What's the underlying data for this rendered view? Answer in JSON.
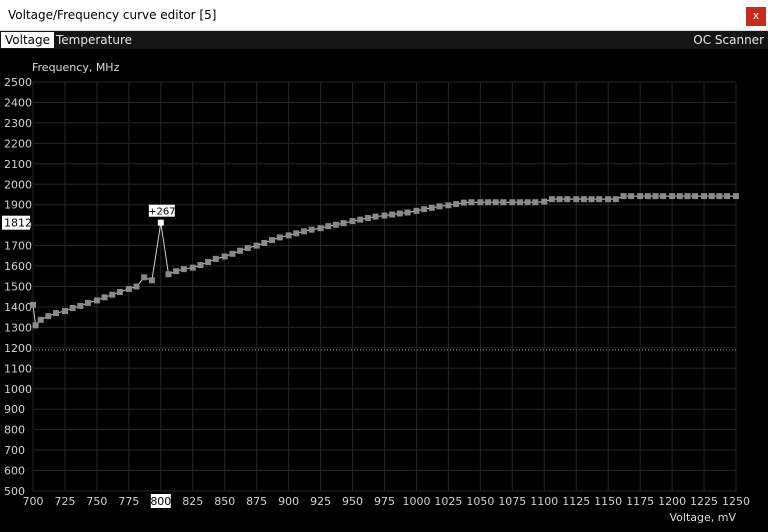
{
  "window": {
    "title": "Voltage/Frequency curve editor [5]",
    "close_label": "x"
  },
  "tabs": [
    {
      "label": "Voltage",
      "active": true
    },
    {
      "label": "Temperature",
      "active": false
    }
  ],
  "oc_scanner_label": "OC Scanner",
  "colors": {
    "background": "#000000",
    "grid": "#262626",
    "curve": "#8a8a8a",
    "selected_point": "#ffffff",
    "tab_active_bg": "#ffffff"
  },
  "chart_data": {
    "type": "line",
    "ylabel": "Frequency, MHz",
    "xlabel": "Voltage, mV",
    "xlim": [
      700,
      1250
    ],
    "ylim": [
      500,
      2500
    ],
    "x_ticks": [
      700,
      725,
      750,
      775,
      800,
      825,
      850,
      875,
      900,
      925,
      950,
      975,
      1000,
      1025,
      1050,
      1075,
      1100,
      1125,
      1150,
      1175,
      1200,
      1225,
      1250
    ],
    "y_ticks": [
      500,
      600,
      700,
      800,
      900,
      1000,
      1100,
      1200,
      1300,
      1400,
      1500,
      1600,
      1700,
      1800,
      1900,
      2000,
      2100,
      2200,
      2300,
      2400,
      2500
    ],
    "grid": true,
    "reference_line_y": 1190,
    "highlighted_x_tick": 800,
    "highlighted_y_value": "1812",
    "selected_point": {
      "x": 800,
      "y": 1812,
      "offset_label": "+267"
    },
    "series": [
      {
        "points": [
          [
            700,
            1410
          ],
          [
            702,
            1310
          ],
          [
            706,
            1337
          ],
          [
            712,
            1355
          ],
          [
            718,
            1370
          ],
          [
            725,
            1380
          ],
          [
            731,
            1395
          ],
          [
            737,
            1405
          ],
          [
            743,
            1420
          ],
          [
            750,
            1432
          ],
          [
            756,
            1447
          ],
          [
            762,
            1460
          ],
          [
            768,
            1473
          ],
          [
            775,
            1488
          ],
          [
            781,
            1500
          ],
          [
            787,
            1545
          ],
          [
            793,
            1530
          ],
          [
            800,
            1812
          ],
          [
            806,
            1560
          ],
          [
            812,
            1575
          ],
          [
            818,
            1585
          ],
          [
            825,
            1592
          ],
          [
            831,
            1605
          ],
          [
            837,
            1620
          ],
          [
            843,
            1635
          ],
          [
            850,
            1647
          ],
          [
            856,
            1660
          ],
          [
            862,
            1675
          ],
          [
            868,
            1688
          ],
          [
            875,
            1700
          ],
          [
            881,
            1713
          ],
          [
            887,
            1727
          ],
          [
            893,
            1740
          ],
          [
            900,
            1750
          ],
          [
            906,
            1760
          ],
          [
            912,
            1770
          ],
          [
            918,
            1778
          ],
          [
            925,
            1785
          ],
          [
            931,
            1795
          ],
          [
            937,
            1802
          ],
          [
            943,
            1810
          ],
          [
            950,
            1820
          ],
          [
            956,
            1827
          ],
          [
            962,
            1835
          ],
          [
            968,
            1842
          ],
          [
            975,
            1847
          ],
          [
            981,
            1852
          ],
          [
            987,
            1857
          ],
          [
            993,
            1862
          ],
          [
            1000,
            1870
          ],
          [
            1006,
            1878
          ],
          [
            1012,
            1885
          ],
          [
            1018,
            1892
          ],
          [
            1025,
            1897
          ],
          [
            1031,
            1903
          ],
          [
            1037,
            1910
          ],
          [
            1043,
            1912
          ],
          [
            1050,
            1912
          ],
          [
            1056,
            1912
          ],
          [
            1062,
            1912
          ],
          [
            1068,
            1912
          ],
          [
            1075,
            1912
          ],
          [
            1081,
            1912
          ],
          [
            1087,
            1912
          ],
          [
            1093,
            1912
          ],
          [
            1100,
            1915
          ],
          [
            1106,
            1927
          ],
          [
            1112,
            1927
          ],
          [
            1118,
            1927
          ],
          [
            1125,
            1927
          ],
          [
            1131,
            1927
          ],
          [
            1137,
            1927
          ],
          [
            1143,
            1927
          ],
          [
            1150,
            1927
          ],
          [
            1156,
            1927
          ],
          [
            1162,
            1942
          ],
          [
            1168,
            1942
          ],
          [
            1175,
            1942
          ],
          [
            1181,
            1942
          ],
          [
            1187,
            1942
          ],
          [
            1193,
            1942
          ],
          [
            1200,
            1942
          ],
          [
            1206,
            1942
          ],
          [
            1212,
            1942
          ],
          [
            1218,
            1942
          ],
          [
            1225,
            1942
          ],
          [
            1231,
            1942
          ],
          [
            1237,
            1942
          ],
          [
            1243,
            1942
          ],
          [
            1250,
            1942
          ]
        ]
      }
    ]
  }
}
